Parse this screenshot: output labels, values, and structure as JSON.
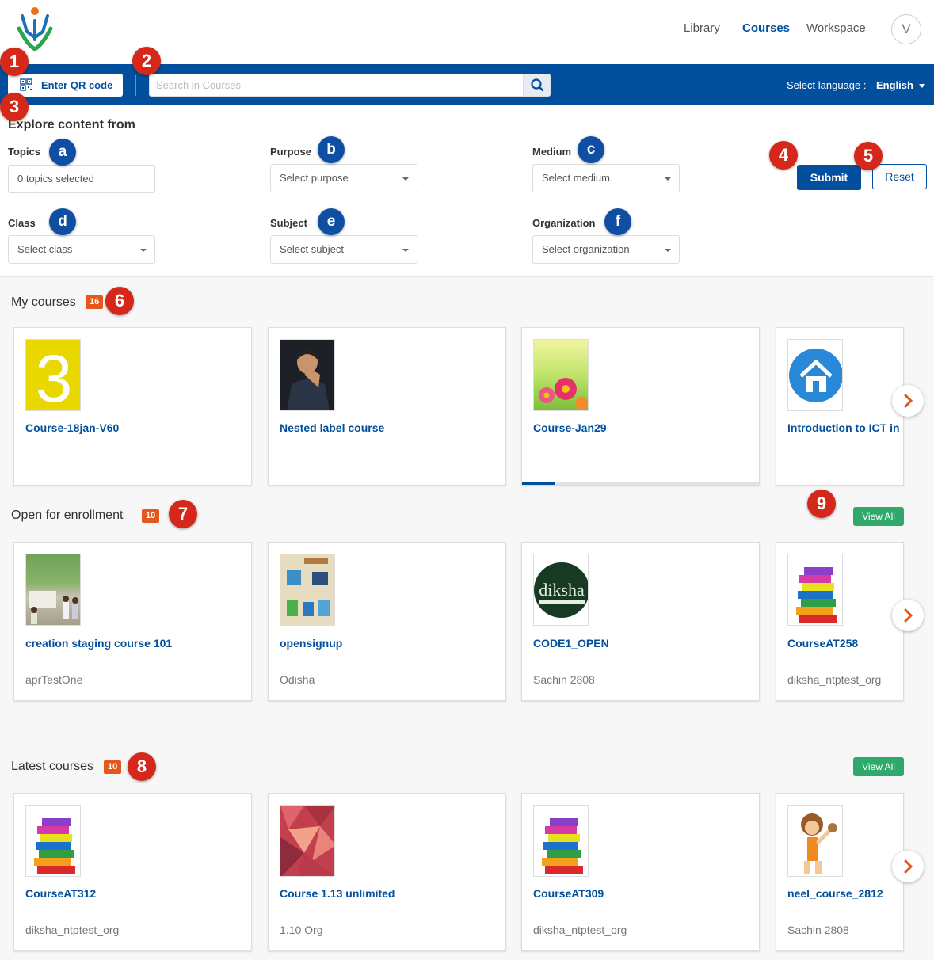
{
  "header": {
    "nav": [
      "Library",
      "Courses",
      "Workspace"
    ],
    "avatar": "V"
  },
  "toolbar": {
    "qr_label": "Enter QR code",
    "search_placeholder": "Search in Courses",
    "language_label": "Select language :",
    "language_value": "English"
  },
  "filters": {
    "title": "Explore content from",
    "topics": {
      "label": "Topics",
      "value": "0 topics selected"
    },
    "purpose": {
      "label": "Purpose",
      "value": "Select purpose"
    },
    "medium": {
      "label": "Medium",
      "value": "Select medium"
    },
    "class": {
      "label": "Class",
      "value": "Select class"
    },
    "subject": {
      "label": "Subject",
      "value": "Select subject"
    },
    "organization": {
      "label": "Organization",
      "value": "Select organization"
    },
    "submit": "Submit",
    "reset": "Reset"
  },
  "markers": {
    "numbers": [
      "1",
      "2",
      "3",
      "4",
      "5",
      "6",
      "7",
      "8",
      "9"
    ],
    "letters": [
      "a",
      "b",
      "c",
      "d",
      "e",
      "f"
    ]
  },
  "sections": {
    "my_courses": {
      "title": "My courses",
      "count": "16",
      "cards": [
        {
          "title": "Course-18jan-V60",
          "thumb": "number-three-thumb"
        },
        {
          "title": "Nested label course",
          "thumb": "tennis-player-photo"
        },
        {
          "title": "Course-Jan29",
          "thumb": "flowers-photo",
          "progress_fraction": 0.14
        },
        {
          "title": "Introduction to ICT in",
          "thumb": "home-icon-thumb"
        }
      ]
    },
    "open_enrollment": {
      "title": "Open for enrollment",
      "count": "10",
      "view_all": "View All",
      "cards": [
        {
          "title": "creation staging course 101",
          "org": "aprTestOne",
          "thumb": "outdoor-group-photo"
        },
        {
          "title": "opensignup",
          "org": "Odisha",
          "thumb": "waste-bins-poster"
        },
        {
          "title": "CODE1_OPEN",
          "org": "Sachin 2808",
          "thumb": "diksha-logo-thumb"
        },
        {
          "title": "CourseAT258",
          "org": "diksha_ntptest_org",
          "thumb": "books-stack-icon"
        }
      ]
    },
    "latest": {
      "title": "Latest courses",
      "count": "10",
      "view_all": "View All",
      "cards": [
        {
          "title": "CourseAT312",
          "org": "diksha_ntptest_org",
          "thumb": "books-stack-icon"
        },
        {
          "title": "Course 1.13 unlimited",
          "org": "1.10 Org",
          "thumb": "geometric-pattern-thumb"
        },
        {
          "title": "CourseAT309",
          "org": "diksha_ntptest_org",
          "thumb": "books-stack-icon"
        },
        {
          "title": "neel_course_2812",
          "org": "Sachin 2808",
          "thumb": "cartoon-character-thumb"
        }
      ]
    }
  },
  "colors": {
    "brand_blue": "#024f9d",
    "badge_orange": "#e5571a",
    "view_all_green": "#2fa86b",
    "marker_red": "#d5281b",
    "marker_blue": "#0f4fa3"
  }
}
